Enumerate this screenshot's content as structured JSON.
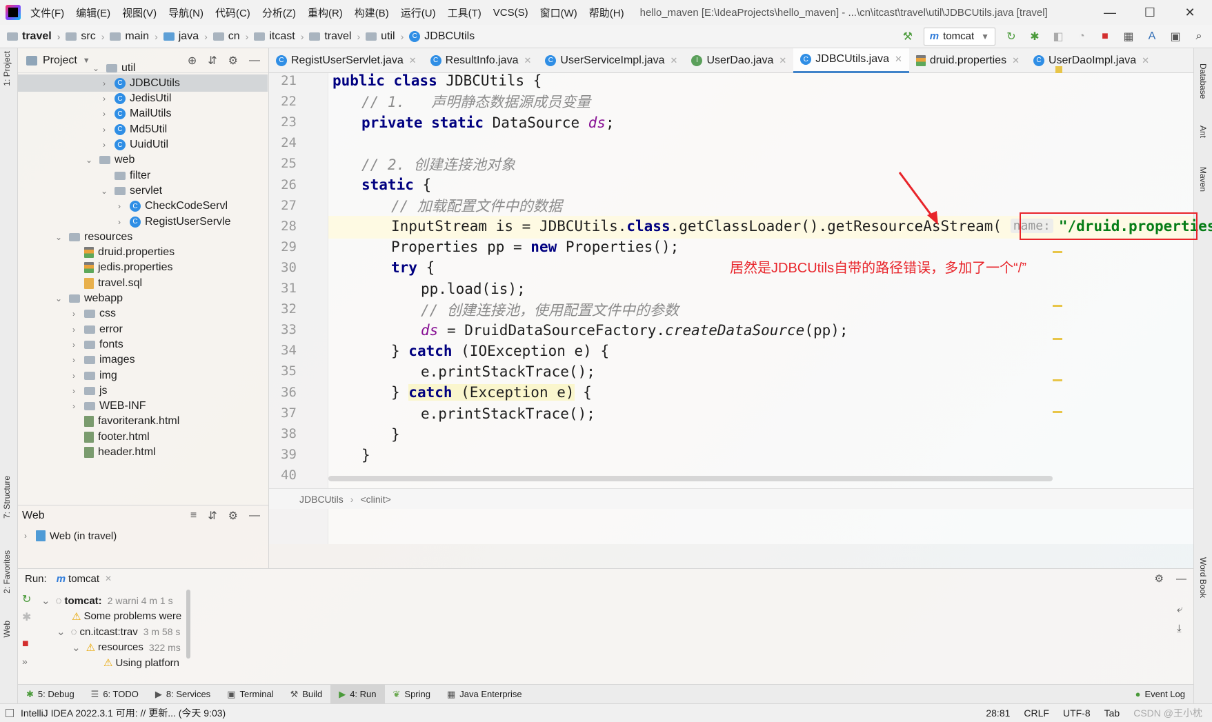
{
  "menu": [
    "文件(F)",
    "编辑(E)",
    "视图(V)",
    "导航(N)",
    "代码(C)",
    "分析(Z)",
    "重构(R)",
    "构建(B)",
    "运行(U)",
    "工具(T)",
    "VCS(S)",
    "窗口(W)",
    "帮助(H)"
  ],
  "window_title": "hello_maven [E:\\IdeaProjects\\hello_maven] - ...\\cn\\itcast\\travel\\util\\JDBCUtils.java [travel]",
  "window_controls": {
    "minimize": "—",
    "maximize": "☐",
    "close": "✕"
  },
  "breadcrumb": [
    "travel",
    "src",
    "main",
    "java",
    "cn",
    "itcast",
    "travel",
    "util",
    "JDBCUtils"
  ],
  "run_config": "tomcat",
  "left_stripe_tabs": [
    "1: Project",
    "7: Structure",
    "2: Favorites",
    "Web"
  ],
  "right_stripe_tabs": [
    "Database",
    "Ant",
    "Maven",
    "Word Book"
  ],
  "project_panel": {
    "title": "Project",
    "tree": [
      {
        "label": "util",
        "type": "folder",
        "arrow": "down"
      },
      {
        "label": "JDBCUtils",
        "type": "class",
        "arrow": "right",
        "selected": true
      },
      {
        "label": "JedisUtil",
        "type": "class",
        "arrow": "right"
      },
      {
        "label": "MailUtils",
        "type": "class",
        "arrow": "right"
      },
      {
        "label": "Md5Util",
        "type": "class",
        "arrow": "right"
      },
      {
        "label": "UuidUtil",
        "type": "class",
        "arrow": "right"
      },
      {
        "label": "web",
        "type": "folder",
        "arrow": "down"
      },
      {
        "label": "filter",
        "type": "folder",
        "arrow": ""
      },
      {
        "label": "servlet",
        "type": "folder",
        "arrow": "down"
      },
      {
        "label": "CheckCodeServl",
        "type": "class",
        "arrow": "right"
      },
      {
        "label": "RegistUserServle",
        "type": "class",
        "arrow": "right"
      },
      {
        "label": "resources",
        "type": "folder",
        "arrow": "down"
      },
      {
        "label": "druid.properties",
        "type": "props",
        "arrow": ""
      },
      {
        "label": "jedis.properties",
        "type": "props",
        "arrow": ""
      },
      {
        "label": "travel.sql",
        "type": "sql",
        "arrow": ""
      },
      {
        "label": "webapp",
        "type": "folder",
        "arrow": "down"
      },
      {
        "label": "css",
        "type": "folder",
        "arrow": "right"
      },
      {
        "label": "error",
        "type": "folder",
        "arrow": "right"
      },
      {
        "label": "fonts",
        "type": "folder",
        "arrow": "right"
      },
      {
        "label": "images",
        "type": "folder",
        "arrow": "right"
      },
      {
        "label": "img",
        "type": "folder",
        "arrow": "right"
      },
      {
        "label": "js",
        "type": "folder",
        "arrow": "right"
      },
      {
        "label": "WEB-INF",
        "type": "folder",
        "arrow": "right"
      },
      {
        "label": "favoriterank.html",
        "type": "html",
        "arrow": ""
      },
      {
        "label": "footer.html",
        "type": "html",
        "arrow": ""
      },
      {
        "label": "header.html",
        "type": "html",
        "arrow": ""
      }
    ]
  },
  "web_panel": {
    "title": "Web",
    "item": "Web (in travel)"
  },
  "editor_tabs": [
    {
      "label": "RegistUserServlet.java",
      "icon": "class"
    },
    {
      "label": "ResultInfo.java",
      "icon": "class"
    },
    {
      "label": "UserServiceImpl.java",
      "icon": "class"
    },
    {
      "label": "UserDao.java",
      "icon": "interface"
    },
    {
      "label": "JDBCUtils.java",
      "icon": "class",
      "active": true
    },
    {
      "label": "druid.properties",
      "icon": "props"
    },
    {
      "label": "UserDaoImpl.java",
      "icon": "class"
    }
  ],
  "code": {
    "line_numbers": [
      "21",
      "22",
      "23",
      "24",
      "25",
      "26",
      "27",
      "28",
      "29",
      "30",
      "31",
      "32",
      "33",
      "34",
      "35",
      "36",
      "37",
      "38",
      "39",
      "40"
    ],
    "l21": {
      "kw1": "public class",
      "rest": " JDBCUtils {"
    },
    "l22": "// 1.   声明静态数据源成员变量",
    "l23": {
      "kw": "private static",
      "type": " DataSource ",
      "field": "ds",
      "end": ";"
    },
    "l25": "// 2. 创建连接池对象",
    "l26": {
      "kw": "static",
      "rest": " {"
    },
    "l27": "// 加载配置文件中的数据",
    "l28": {
      "a": "InputStream is = JDBCUtils.",
      "kw": "class",
      "b": ".getClassLoader().getResourceAsStream( ",
      "hint": "name:",
      "str": "\"/druid.properties\""
    },
    "l29": {
      "a": "Properties pp = ",
      "kw": "new",
      "b": " Properties();"
    },
    "l30": {
      "kw": "try",
      "rest": " {"
    },
    "l31": "pp.load(is);",
    "l32": "// 创建连接池，使用配置文件中的参数",
    "l33": {
      "field": "ds",
      "a": " = DruidDataSourceFactory.",
      "st": "createDataSource",
      "b": "(pp);"
    },
    "l34": {
      "a": "} ",
      "kw": "catch",
      "b": " (IOException e) {"
    },
    "l35": "e.printStackTrace();",
    "l36": {
      "a": "} ",
      "kw": "catch",
      "b": " (Exception e)",
      "c": " {"
    },
    "l37": "e.printStackTrace();",
    "l38": "}",
    "l39": "}"
  },
  "annotation": "居然是JDBCUtils自带的路径错误，多加了一个“/”",
  "editor_breadcrumb": [
    "JDBCUtils",
    "<clinit>"
  ],
  "run_panel": {
    "label": "Run:",
    "config": "tomcat",
    "rows": [
      {
        "text": "tomcat:",
        "meta": "2 warni 4 m 1 s",
        "icon": "spin"
      },
      {
        "text": "Some problems were",
        "meta": "",
        "icon": "warn"
      },
      {
        "text": "cn.itcast:trav",
        "meta": "3 m 58 s",
        "icon": "spin"
      },
      {
        "text": "resources",
        "meta": "322 ms",
        "icon": "warn"
      },
      {
        "text": "Using platforn",
        "meta": "",
        "icon": "warn"
      }
    ]
  },
  "tool_tabs": [
    "5: Debug",
    "6: TODO",
    "8: Services",
    "Terminal",
    "Build",
    "4: Run",
    "Spring",
    "Java Enterprise"
  ],
  "event_log": "Event Log",
  "status": {
    "message": "IntelliJ IDEA 2022.3.1 可用: // 更新... (今天 9:03)",
    "position": "28:81",
    "line_sep": "CRLF",
    "encoding": "UTF-8",
    "indent": "Tab",
    "watermark": "CSDN @王小枕"
  },
  "colors": {
    "accent": "#4083c9",
    "annotation_red": "#e8242a",
    "keyword": "#000080",
    "string": "#067d17",
    "field": "#871094"
  }
}
